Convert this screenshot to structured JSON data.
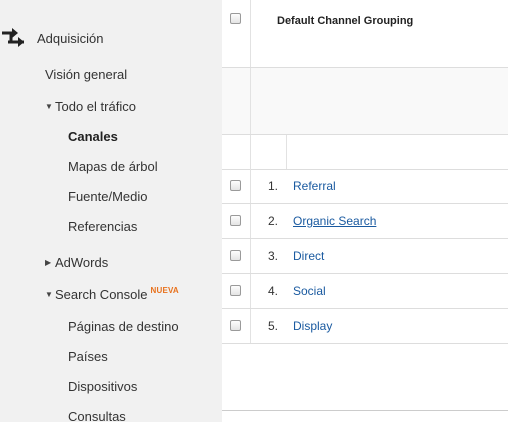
{
  "sidebar": {
    "section_label": "Adquisición",
    "overview": "Visión general",
    "all_traffic": {
      "label": "Todo el tráfico",
      "items": [
        "Canales",
        "Mapas de árbol",
        "Fuente/Medio",
        "Referencias"
      ]
    },
    "adwords": "AdWords",
    "search_console": {
      "label": "Search Console",
      "badge": "NUEVA",
      "items": [
        "Páginas de destino",
        "Países",
        "Dispositivos",
        "Consultas"
      ]
    },
    "active_item": "Canales"
  },
  "table": {
    "header": "Default Channel Grouping",
    "rows": [
      {
        "rank": "1.",
        "channel": "Referral"
      },
      {
        "rank": "2.",
        "channel": "Organic Search"
      },
      {
        "rank": "3.",
        "channel": "Direct"
      },
      {
        "rank": "4.",
        "channel": "Social"
      },
      {
        "rank": "5.",
        "channel": "Display"
      }
    ]
  },
  "colors": {
    "link": "#1a5aa0",
    "badge": "#e8711c",
    "sidebar_bg": "#f1f1f1"
  },
  "icons": {
    "section": "acquisition-arrows-icon",
    "expanded": "triangle-down-icon",
    "collapsed": "triangle-right-icon"
  }
}
